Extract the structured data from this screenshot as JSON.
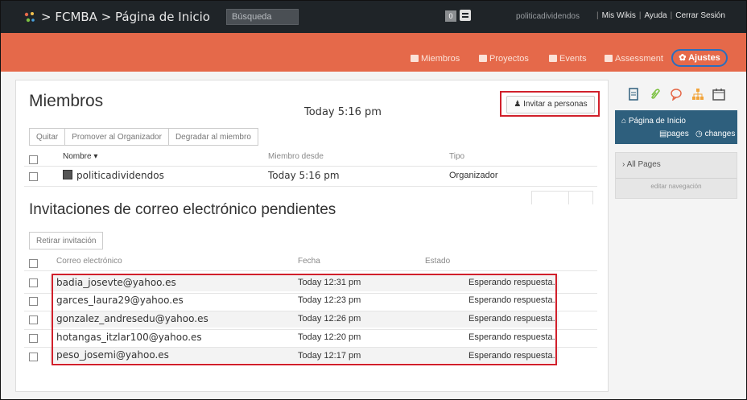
{
  "topbar": {
    "breadcrumb": "> FCMBA > Página de Inicio",
    "search_placeholder": "Búsqueda",
    "badge_count": "0",
    "username": "politicadividendos",
    "links": [
      "Mis Wikis",
      "Ayuda",
      "Cerrar Sesión"
    ]
  },
  "nav": {
    "items": [
      "Miembros",
      "Proyectos",
      "Events",
      "Assessment"
    ],
    "settings_label": "Ajustes"
  },
  "members": {
    "title": "Miembros",
    "timestamp": "Today 5:16 pm",
    "invite_label": "Invitar a personas",
    "actions": [
      "Quitar",
      "Promover al Organizador",
      "Degradar al miembro"
    ],
    "columns": {
      "name": "Nombre ▾",
      "since": "Miembro desde",
      "type": "Tipo"
    },
    "rows": [
      {
        "name": "politicadividendos",
        "since": "Today 5:16 pm",
        "type": "Organizador"
      }
    ]
  },
  "invitations": {
    "title": "Invitaciones de correo electrónico pendientes",
    "withdraw_label": "Retirar invitación",
    "columns": {
      "email": "Correo electrónico",
      "date": "Fecha",
      "status": "Estado"
    },
    "rows": [
      {
        "email": "badia_josevte@yahoo.es",
        "date": "Today 12:31 pm",
        "status": "Esperando respuesta."
      },
      {
        "email": "garces_laura29@yahoo.es",
        "date": "Today 12:23 pm",
        "status": "Esperando respuesta."
      },
      {
        "email": "gonzalez_andresedu@yahoo.es",
        "date": "Today 12:26 pm",
        "status": "Esperando respuesta."
      },
      {
        "email": "hotangas_itzlar100@yahoo.es",
        "date": "Today 12:20 pm",
        "status": "Esperando respuesta."
      },
      {
        "email": "peso_josemi@yahoo.es",
        "date": "Today 12:17 pm",
        "status": "Esperando respuesta."
      }
    ]
  },
  "sidebar": {
    "icons": [
      "page-icon",
      "paperclip-icon",
      "comment-icon",
      "sitemap-icon",
      "calendar-icon"
    ],
    "home_label": "Página de Inicio",
    "pages_label": "pages",
    "changes_label": "changes",
    "all_pages_label": "All Pages",
    "edit_nav_label": "editar navegación"
  },
  "colors": {
    "topbar": "#1f2428",
    "accent": "#e5694a",
    "highlight_red": "#d1202b",
    "highlight_blue": "#2a6ebd",
    "sidebar_blue": "#2e5f7d"
  }
}
